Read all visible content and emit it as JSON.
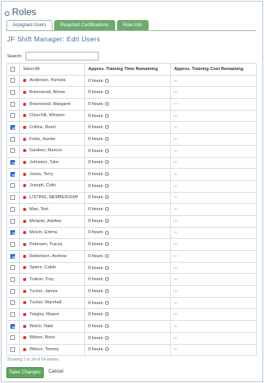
{
  "window": {
    "title": "Roles"
  },
  "tabs": [
    {
      "label": "Assigned Users",
      "active": true
    },
    {
      "label": "Required Certifications",
      "active": false
    },
    {
      "label": "Role Info",
      "active": false
    }
  ],
  "page_title": "JF Shift Manager: Edit Users",
  "search": {
    "label": "Search:",
    "value": ""
  },
  "table": {
    "columns": [
      "Select All",
      "Approx. Training Time Remaining",
      "Approx. Training Cost Remaining"
    ],
    "rows": [
      {
        "name": "Anderson, Pamela",
        "checked": false,
        "time": "0 hours",
        "cost": "--"
      },
      {
        "name": "Breerwood, Aimee",
        "checked": false,
        "time": "0 hours",
        "cost": "--"
      },
      {
        "name": "Breerwood, Margaret",
        "checked": false,
        "time": "0 hours",
        "cost": "--"
      },
      {
        "name": "Churchill, Winston",
        "checked": false,
        "time": "0 hours",
        "cost": "--"
      },
      {
        "name": "Collins, Reed",
        "checked": true,
        "time": "0 hours",
        "cost": "--"
      },
      {
        "name": "Folse, Hunter",
        "checked": false,
        "time": "0 hours",
        "cost": "--"
      },
      {
        "name": "Gardner, Marcus",
        "checked": false,
        "time": "0 hours",
        "cost": "--"
      },
      {
        "name": "Johnston, Tyler",
        "checked": true,
        "time": "0 hours",
        "cost": "--"
      },
      {
        "name": "Jones, Terry",
        "checked": true,
        "time": "0 hours",
        "cost": "--"
      },
      {
        "name": "Joseph, Colin",
        "checked": false,
        "time": "0 hours",
        "cost": "--"
      },
      {
        "name": "LISTING, MEMBERSHIP",
        "checked": false,
        "time": "0 hours",
        "cost": "--"
      },
      {
        "name": "Man, Test",
        "checked": false,
        "time": "0 hours",
        "cost": "--"
      },
      {
        "name": "Melanie, Adeline",
        "checked": false,
        "time": "0 hours",
        "cost": "--"
      },
      {
        "name": "Melvin, Emma",
        "checked": true,
        "time": "0 hours",
        "cost": "--"
      },
      {
        "name": "Petersen, Tracey",
        "checked": false,
        "time": "0 hours",
        "cost": "--"
      },
      {
        "name": "Robertson, Andrew",
        "checked": true,
        "time": "0 hours",
        "cost": "--"
      },
      {
        "name": "Spiers, Caleb",
        "checked": false,
        "time": "0 hours",
        "cost": "--"
      },
      {
        "name": "Trainer, Troy",
        "checked": false,
        "time": "0 hours",
        "cost": "--"
      },
      {
        "name": "Tucker, James",
        "checked": false,
        "time": "0 hours",
        "cost": "--"
      },
      {
        "name": "Tucker, Marshall",
        "checked": false,
        "time": "0 hours",
        "cost": "--"
      },
      {
        "name": "Twigley, Mason",
        "checked": false,
        "time": "0 hours",
        "cost": "--"
      },
      {
        "name": "Welch, Nate",
        "checked": true,
        "time": "0 hours",
        "cost": "--"
      },
      {
        "name": "Wilson, Boris",
        "checked": false,
        "time": "0 hours",
        "cost": "--"
      },
      {
        "name": "Wilson, Tommy",
        "checked": false,
        "time": "0 hours",
        "cost": "--"
      }
    ]
  },
  "footer": {
    "showing": "Showing 1 to 24 of 24 entries",
    "save_label": "Save Changes",
    "cancel_label": "Cancel"
  },
  "colors": {
    "accent_green": "#6ea96e",
    "title_blue": "#3d5970",
    "status_dot": "#e0322f",
    "checkbox_checked": "#2d6fcb"
  },
  "icons": {
    "help": "question-circle-icon",
    "status": "red-dot-icon"
  }
}
